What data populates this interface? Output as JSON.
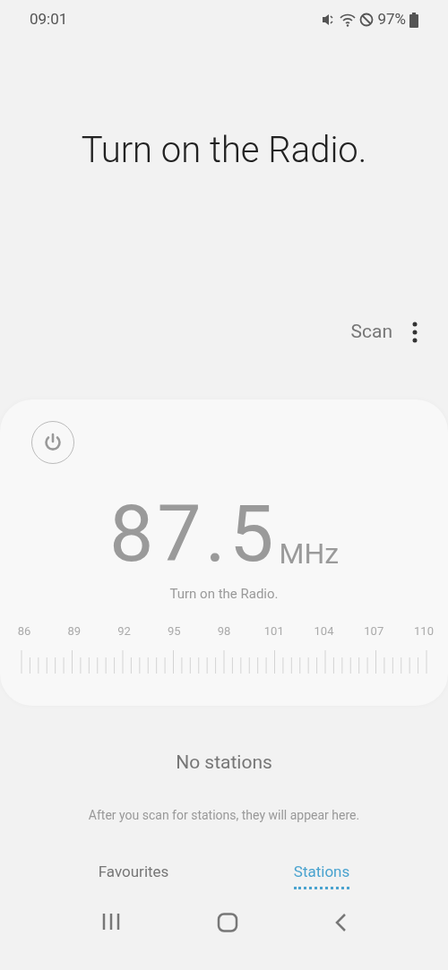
{
  "status_bar": {
    "time": "09:01",
    "battery": "97%"
  },
  "headline": "Turn on the Radio.",
  "toolbar": {
    "scan": "Scan"
  },
  "tuner": {
    "power_on": false,
    "frequency": "87.5",
    "unit": "MHz",
    "message": "Turn on the Radio.",
    "scale_labels": [
      "86",
      "89",
      "92",
      "95",
      "98",
      "101",
      "104",
      "107",
      "110"
    ]
  },
  "empty_state": {
    "title": "No stations",
    "hint": "After you scan for stations, they will appear here."
  },
  "tabs": [
    {
      "label": "Favourites",
      "selected": false
    },
    {
      "label": "Stations",
      "selected": true
    }
  ]
}
